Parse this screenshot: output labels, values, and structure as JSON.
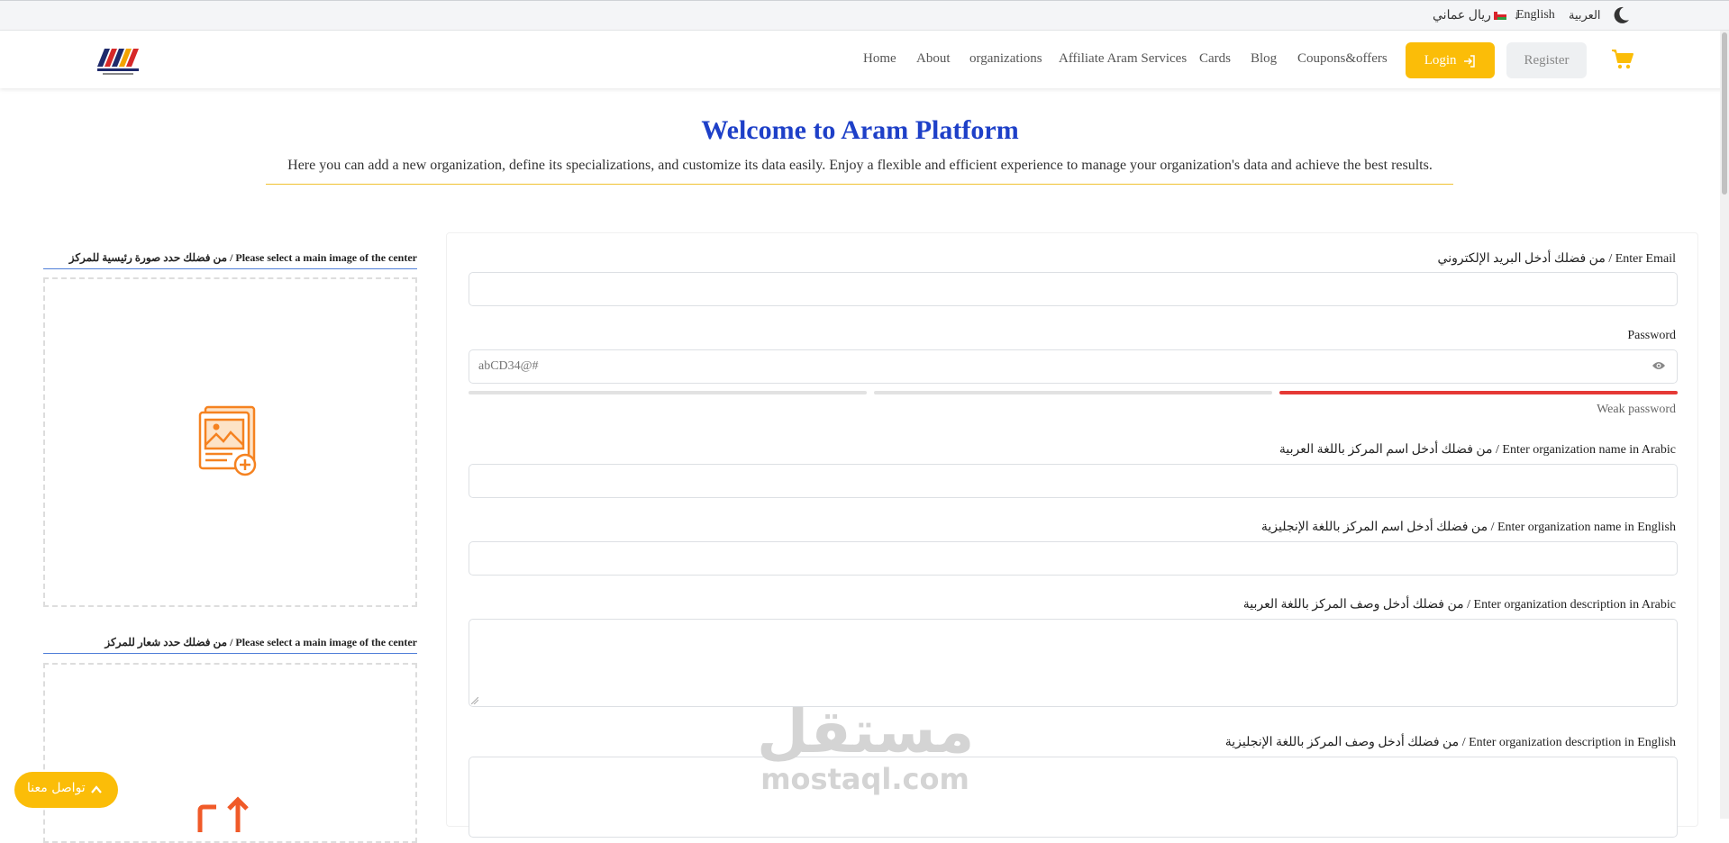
{
  "topbar": {
    "currency": "ريال عماني",
    "currency_arrow": "↓",
    "lang_english": "English",
    "lang_arabic": "العربية"
  },
  "nav": {
    "links": [
      "Home",
      "About",
      "organizations",
      "Affiliate Aram Services",
      "Cards",
      "Blog",
      "Coupons&offers"
    ],
    "login": "Login",
    "register": "Register"
  },
  "hero": {
    "title": "Welcome to Aram Platform",
    "subtitle": "Here you can add a new organization, define its specializations, and customize its data easily. Enjoy a flexible and efficient experience to manage your organization's data and achieve the best results."
  },
  "uploads": {
    "main_image_label": "من فضلك حدد صورة رئيسية للمركز / Please select a main image of the center",
    "logo_label": "من فضلك حدد شعار للمركز / Please select a main image of the center"
  },
  "form": {
    "email_label": "من فضلك أدخل البريد الإلكتروني / Enter Email",
    "password_label": "Password",
    "password_value": "abCD34@#",
    "password_strength": "Weak password",
    "name_ar_label": "من فضلك أدخل اسم المركز باللغة العربية / Enter organization name in Arabic",
    "name_en_label": "من فضلك أدخل اسم المركز باللغة الإنجليزية / Enter organization name in English",
    "desc_ar_label": "من فضلك أدخل وصف المركز باللغة العربية / Enter organization description in Arabic",
    "desc_en_label": "من فضلك أدخل وصف المركز باللغة الإنجليزية / Enter organization description in English"
  },
  "watermark": {
    "arabic": "مستقل",
    "latin": "mostaql.com"
  },
  "contact": {
    "label": "تواصل معنا"
  },
  "colors": {
    "accent": "#fbbd08",
    "title": "#1e40c8",
    "strength_weak": "#e53935"
  }
}
